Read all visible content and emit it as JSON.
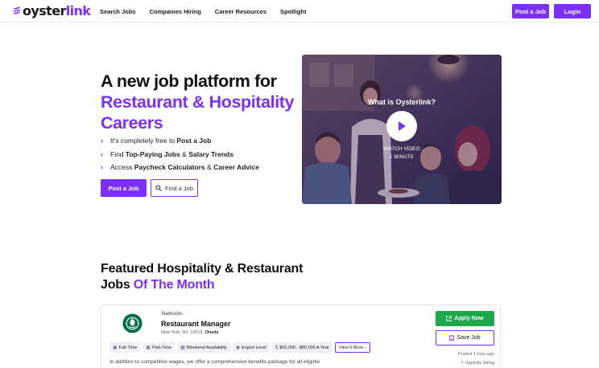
{
  "header": {
    "logo": {
      "text_main": "oyster",
      "text_accent": "link"
    },
    "nav": [
      "Search Jobs",
      "Companies Hiring",
      "Career Resources",
      "Spotlight"
    ],
    "post_job_label": "Post a Job",
    "login_label": "Login"
  },
  "hero": {
    "title_line1": "A new job platform for",
    "title_accent": "Restaurant & Hospitality Careers",
    "bullets": [
      {
        "pre": "It's completely free to ",
        "bold1": "Post a Job",
        "mid": "",
        "bold2": ""
      },
      {
        "pre": "Find ",
        "bold1": "Top-Paying Jobs",
        "mid": " & ",
        "bold2": "Salary Trends"
      },
      {
        "pre": "Access ",
        "bold1": "Paycheck Calculators",
        "mid": " & ",
        "bold2": "Career Advice"
      }
    ],
    "post_button": "Post a Job",
    "find_button": "Find a Job"
  },
  "video": {
    "title": "What is Oysterlink?",
    "watch": "WATCH VIDEO",
    "duration": "1 MINUTE"
  },
  "featured": {
    "title_line1": "Featured Hospitality & Restaurant",
    "title_line2": "Jobs ",
    "title_accent": "Of The Month"
  },
  "job": {
    "company": "Starbucks",
    "title": "Restaurant Manager",
    "location": "New York, NY, 10019",
    "work_type": "Onsite",
    "tags": [
      {
        "icon": "briefcase-icon",
        "label": "Full-Time"
      },
      {
        "icon": "briefcase-icon",
        "label": "Part-Time"
      },
      {
        "icon": "calendar-icon",
        "label": "Weekend Availability"
      },
      {
        "icon": "pin-icon",
        "label": "Expert Level"
      },
      {
        "icon": "money-icon",
        "label": "$65,000 - $80,000 A Year"
      }
    ],
    "more_label": "View 6 More",
    "apply_label": "Apply Now",
    "save_label": "Save Job",
    "posted": "Posted 1 hour ago",
    "urgent": "Urgently Hiring",
    "description": "In addition to competitive wages, we offer a comprehensive benefits package for all eligible"
  },
  "colors": {
    "brand": "#7b2ff7",
    "apply": "#1ea84b",
    "starbucks": "#00704a"
  }
}
